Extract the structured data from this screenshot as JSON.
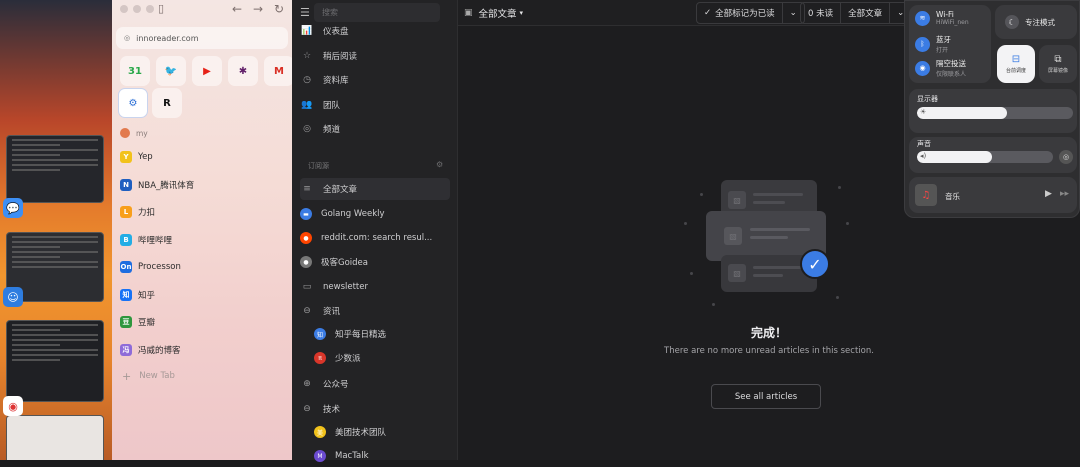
{
  "browser": {
    "url": "innoreader.com",
    "toolbar_icons": [
      "sidebar-icon",
      "back-icon",
      "forward-icon",
      "reload-icon"
    ],
    "favorites_row1": [
      {
        "name": "calendar",
        "glyph": "31",
        "color": "#2aa84a"
      },
      {
        "name": "twitter",
        "glyph": "🐦",
        "color": "#1d9bf0"
      },
      {
        "name": "youtube",
        "glyph": "▶",
        "color": "#e62117"
      },
      {
        "name": "slack",
        "glyph": "✱",
        "color": "#611f69"
      },
      {
        "name": "gmail",
        "glyph": "M",
        "color": "#d93025"
      }
    ],
    "favorites_row2": [
      {
        "name": "inoreader",
        "glyph": "⚙",
        "color": "#2b6fd6"
      },
      {
        "name": "notion",
        "glyph": "R",
        "color": "#111"
      }
    ],
    "section_label": "my",
    "tabs": [
      {
        "label": "Yep",
        "icon": "Y",
        "color": "#f2c21b"
      },
      {
        "label": "NBA_腾讯体育",
        "icon": "N",
        "color": "#1f5fc0"
      },
      {
        "label": "力扣",
        "icon": "L",
        "color": "#f89f1b"
      },
      {
        "label": "哔哩哔哩",
        "icon": "B",
        "color": "#23ade5"
      },
      {
        "label": "Processon",
        "icon": "On",
        "color": "#1f6de0"
      },
      {
        "label": "知乎",
        "icon": "知",
        "color": "#1772f6"
      },
      {
        "label": "豆瓣",
        "icon": "豆",
        "color": "#2e963d"
      },
      {
        "label": "冯威的博客",
        "icon": "冯",
        "color": "#8e6bd8"
      }
    ],
    "new_tab": "New Tab"
  },
  "sidebar": {
    "search_placeholder": "搜索",
    "top_items": [
      {
        "label": "仪表盘",
        "icon": "📊"
      },
      {
        "label": "稍后阅读",
        "icon": "☆"
      },
      {
        "label": "资料库",
        "icon": "◷"
      },
      {
        "label": "团队",
        "icon": "👥"
      },
      {
        "label": "频道",
        "icon": "◎"
      }
    ],
    "subscriptions_label": "订阅源",
    "feeds": [
      {
        "label": "全部文章",
        "icon": "≡",
        "active": true
      },
      {
        "label": "Golang Weekly",
        "color": "#3b7ce4",
        "glyph": "▬"
      },
      {
        "label": "reddit.com: search resul...",
        "color": "#ff4500",
        "glyph": "●"
      },
      {
        "label": "极客Goidea",
        "color": "#777",
        "glyph": "●"
      },
      {
        "label": "newsletter",
        "icon": "▭"
      },
      {
        "label": "资讯",
        "icon": "⊖"
      }
    ],
    "sub_feeds": [
      {
        "label": "知乎每日精选",
        "color": "#3b7ce4",
        "glyph": "知"
      },
      {
        "label": "少数派",
        "color": "#d9362a",
        "glyph": "π"
      }
    ],
    "bottom_items": [
      {
        "label": "公众号",
        "icon": "⊕"
      },
      {
        "label": "技术",
        "icon": "⊖"
      }
    ],
    "tech_feeds": [
      {
        "label": "美团技术团队",
        "color": "#f2c21b",
        "glyph": "美"
      },
      {
        "label": "MacTalk",
        "color": "#6b4bd1",
        "glyph": "M"
      }
    ]
  },
  "main": {
    "feed_title": "全部文章",
    "mark_all_read": "全部标记为已读",
    "unread_count": "0 未读",
    "view_filter": "全部文章",
    "done_title": "完成！",
    "done_subtitle": "There are no more unread articles in this section.",
    "see_all": "See all articles"
  },
  "control_center": {
    "wifi": {
      "title": "Wi-Fi",
      "sub": "HiWiFi_nen"
    },
    "bluetooth": {
      "title": "蓝牙",
      "sub": "打开"
    },
    "airdrop": {
      "title": "隔空投送",
      "sub": "仅限联系人"
    },
    "focus": "专注模式",
    "tile1": "台前调度",
    "tile2": "屏幕镜像",
    "display_label": "显示器",
    "display_level": 0.58,
    "sound_label": "声音",
    "sound_level": 0.55,
    "music_label": "音乐"
  }
}
